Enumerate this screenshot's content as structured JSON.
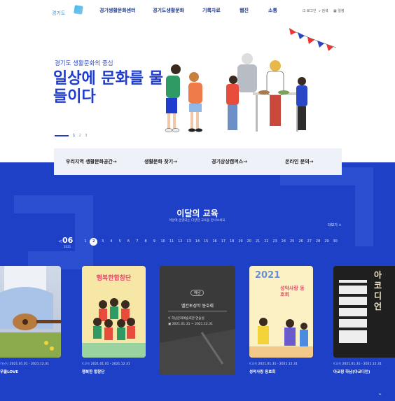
{
  "header": {
    "logo_text": "경기도",
    "logo_sub": "생활문화센터",
    "nav": [
      "경기생활문화센터",
      "경기도생활문화",
      "기록자료",
      "웹진",
      "소통"
    ],
    "util": [
      "로그인",
      "검색",
      "일정"
    ]
  },
  "hero": {
    "subtitle": "경기도 생활문화의 중심",
    "title": "일상에 문화를 물들이다",
    "slides": [
      "1",
      "2",
      "3"
    ]
  },
  "quick_links": [
    "우리지역 생활문화공간→",
    "생활문화 찾기→",
    "경기상상캠퍼스→",
    "온라인 문의→"
  ],
  "education": {
    "title": "이달의 교육",
    "desc": "이달에 운영되는 다양한 교육을 만나보세요.",
    "more": "더보기 +",
    "month": "06",
    "year": "2021",
    "prev": "<",
    "days": [
      "1",
      "2",
      "3",
      "4",
      "5",
      "6",
      "7",
      "8",
      "9",
      "10",
      "11",
      "12",
      "13",
      "14",
      "15",
      "16",
      "17",
      "18",
      "19",
      "20",
      "21",
      "22",
      "23",
      "24",
      "25",
      "26",
      "27",
      "28",
      "29",
      "30"
    ],
    "selected_day": "2"
  },
  "cards": [
    {
      "tag": "하남시",
      "dates": "2021.01.01 - 2021.12.31",
      "title": "우쿨LOVE"
    },
    {
      "tag": "K교육",
      "dates": "2021.01.01 - 2021.12.31",
      "title": "행복한 합창단",
      "poster": "행복한합창단"
    },
    {
      "tag": "하남",
      "title": "벨칸토성악 동호회",
      "place": "하남문화예술회관 연습실",
      "dates": "2021.01.31 ~ 2021.12.31"
    },
    {
      "tag": "K교육",
      "dates": "2021.01.31 - 2021.12.31",
      "title": "성악사랑 동호회",
      "poster_year": "2021",
      "poster": "성악사랑 동호회"
    },
    {
      "tag": "K교육",
      "dates": "2021.01.31 - 2021.12.31",
      "title": "아코핑 하남(아코디언)",
      "poster": "아코디언"
    }
  ],
  "top_button": "^"
}
